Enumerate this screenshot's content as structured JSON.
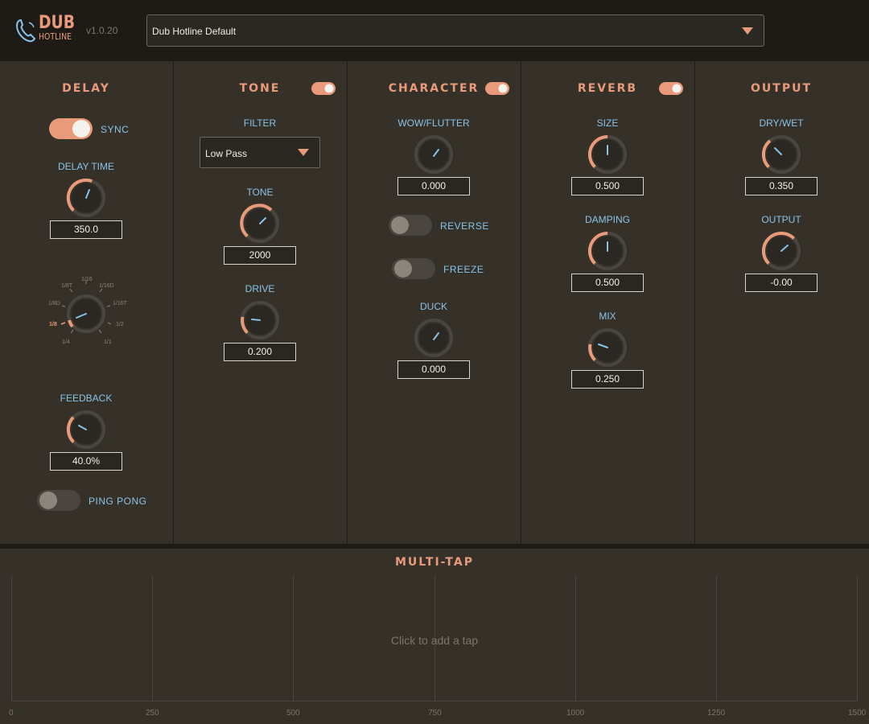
{
  "header": {
    "logo_line1": "DUB",
    "logo_line2": "HOTLINE",
    "version": "v1.0.20",
    "preset": "Dub Hotline Default"
  },
  "delay": {
    "title": "DELAY",
    "sync_label": "SYNC",
    "sync_on": true,
    "time_label": "DELAY TIME",
    "time_value": "350.0",
    "divisions": [
      "1/16",
      "1/8T",
      "1/16D",
      "1/8D",
      "1/16T",
      "1/8",
      "1/2",
      "1/4",
      "1/1"
    ],
    "division_selected": "1/8",
    "feedback_label": "FEEDBACK",
    "feedback_value": "40.0%",
    "pingpong_label": "PING PONG",
    "pingpong_on": false
  },
  "tone": {
    "title": "TONE",
    "enabled": true,
    "filter_label": "FILTER",
    "filter_value": "Low Pass",
    "tone_label": "TONE",
    "tone_value": "2000",
    "drive_label": "DRIVE",
    "drive_value": "0.200"
  },
  "character": {
    "title": "CHARACTER",
    "enabled": true,
    "wow_label": "WOW/FLUTTER",
    "wow_value": "0.000",
    "reverse_label": "REVERSE",
    "reverse_on": false,
    "freeze_label": "FREEZE",
    "freeze_on": false,
    "duck_label": "DUCK",
    "duck_value": "0.000"
  },
  "reverb": {
    "title": "REVERB",
    "enabled": true,
    "size_label": "SIZE",
    "size_value": "0.500",
    "damping_label": "DAMPING",
    "damping_value": "0.500",
    "mix_label": "MIX",
    "mix_value": "0.250"
  },
  "output": {
    "title": "OUTPUT",
    "drywet_label": "DRY/WET",
    "drywet_value": "0.350",
    "output_label": "OUTPUT",
    "output_value": "-0.00"
  },
  "multitap": {
    "title": "MULTI-TAP",
    "hint": "Click to add a tap",
    "ticks": [
      "0",
      "250",
      "500",
      "750",
      "1000",
      "1250",
      "1500"
    ]
  },
  "colors": {
    "accent": "#e89a7a",
    "label": "#8ac2e6",
    "background": "#353129",
    "header": "#1e1b17"
  }
}
